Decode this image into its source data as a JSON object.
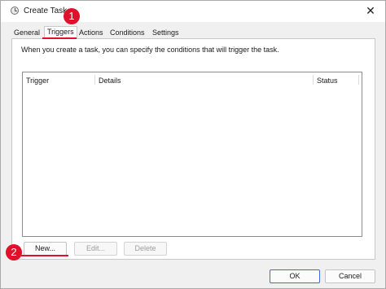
{
  "window": {
    "title": "Create Task",
    "close_glyph": "✕",
    "app_icon": "clock-icon"
  },
  "tabs": [
    {
      "label": "General",
      "active": false
    },
    {
      "label": "Triggers",
      "active": true
    },
    {
      "label": "Actions",
      "active": false
    },
    {
      "label": "Conditions",
      "active": false
    },
    {
      "label": "Settings",
      "active": false
    }
  ],
  "triggers": {
    "description": "When you create a task, you can specify the conditions that will trigger the task.",
    "columns": [
      "Trigger",
      "Details",
      "Status"
    ],
    "rows": [],
    "buttons": {
      "new": "New...",
      "edit": "Edit...",
      "delete": "Delete"
    }
  },
  "footer": {
    "ok": "OK",
    "cancel": "Cancel"
  },
  "annotations": {
    "callout_1": "1",
    "callout_2": "2",
    "color": "#e0112b"
  }
}
